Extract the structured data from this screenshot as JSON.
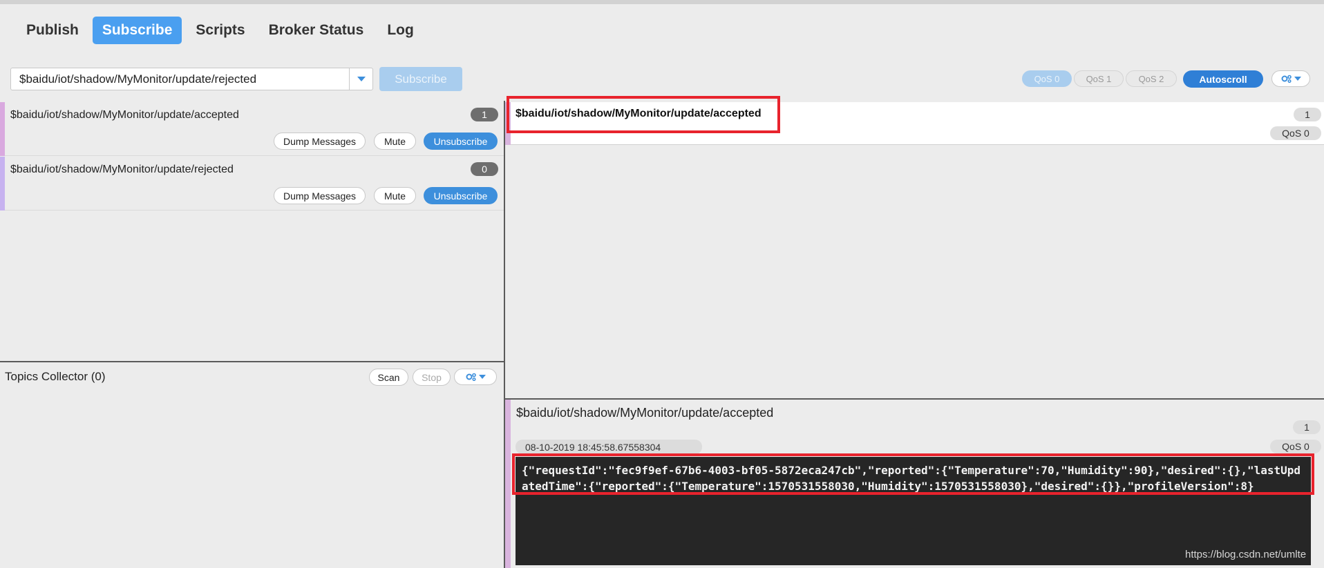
{
  "tabs": [
    {
      "label": "Publish",
      "active": false
    },
    {
      "label": "Subscribe",
      "active": true
    },
    {
      "label": "Scripts",
      "active": false
    },
    {
      "label": "Broker Status",
      "active": false
    },
    {
      "label": "Log",
      "active": false
    }
  ],
  "subscribe_bar": {
    "topic_value": "$baidu/iot/shadow/MyMonitor/update/rejected",
    "button_label": "Subscribe"
  },
  "toolbar": {
    "qos0": "QoS 0",
    "qos1": "QoS 1",
    "qos2": "QoS 2",
    "autoscroll": "Autoscroll",
    "settings_icon": "gears-icon"
  },
  "subscriptions": [
    {
      "topic": "$baidu/iot/shadow/MyMonitor/update/accepted",
      "count": "1",
      "color": "#d9a9df",
      "dump": "Dump Messages",
      "mute": "Mute",
      "unsubscribe": "Unsubscribe"
    },
    {
      "topic": "$baidu/iot/shadow/MyMonitor/update/rejected",
      "count": "0",
      "color": "#c7b2f0",
      "dump": "Dump Messages",
      "mute": "Mute",
      "unsubscribe": "Unsubscribe"
    }
  ],
  "topics_collector": {
    "title": "Topics Collector (0)",
    "scan": "Scan",
    "stop": "Stop"
  },
  "messages": [
    {
      "topic": "$baidu/iot/shadow/MyMonitor/update/accepted",
      "number": "1",
      "qos": "QoS 0"
    }
  ],
  "detail": {
    "topic": "$baidu/iot/shadow/MyMonitor/update/accepted",
    "number": "1",
    "timestamp": "08-10-2019  18:45:58.67558304",
    "qos": "QoS 0",
    "payload": "{\"requestId\":\"fec9f9ef-67b6-4003-bf05-5872eca247cb\",\"reported\":{\"Temperature\":70,\"Humidity\":90},\"desired\":{},\"lastUpdatedTime\":{\"reported\":{\"Temperature\":1570531558030,\"Humidity\":1570531558030},\"desired\":{}},\"profileVersion\":8}"
  },
  "watermark": "https://blog.csdn.net/umlte",
  "colors": {
    "accent": "#3d8fdc",
    "highlight_border": "#e8232d",
    "payload_bg": "#262626"
  }
}
